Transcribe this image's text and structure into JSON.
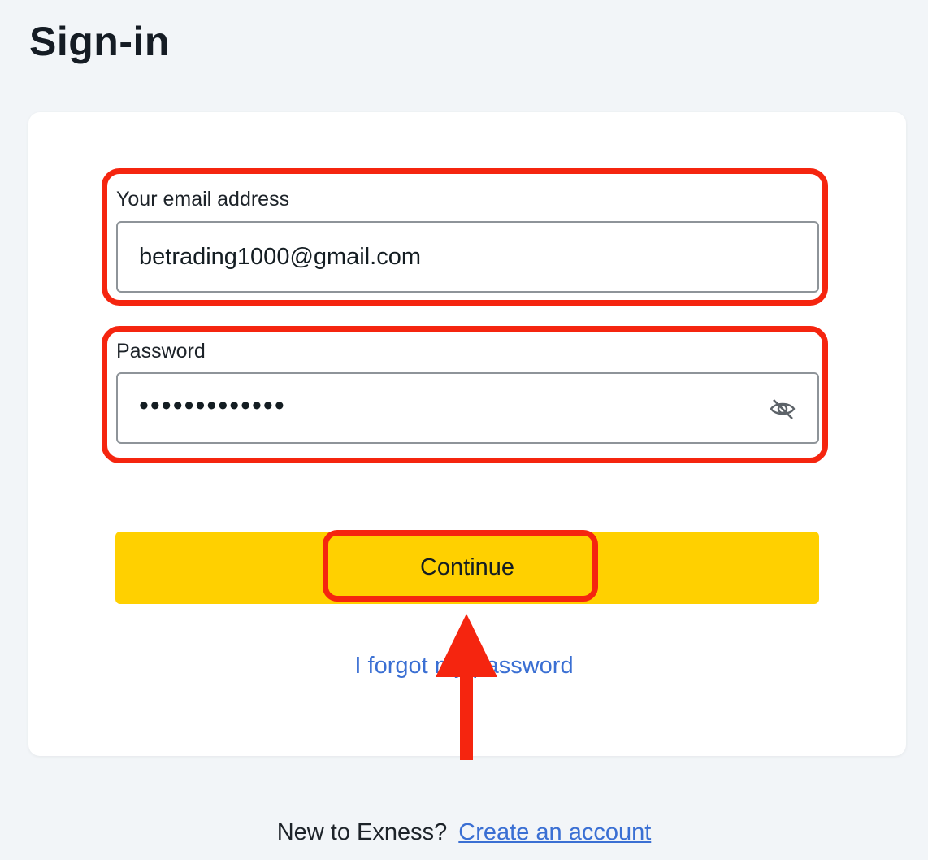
{
  "page": {
    "title": "Sign-in"
  },
  "form": {
    "email_label": "Your email address",
    "email_value": "betrading1000@gmail.com",
    "password_label": "Password",
    "password_value": "•••••••••••••",
    "password_toggle_icon": "eye-slash-icon",
    "continue_label": "Continue",
    "forgot_label": "I forgot my password"
  },
  "footer": {
    "prompt": "New to Exness?",
    "create_label": "Create an account"
  },
  "colors": {
    "accent_yellow": "#ffd000",
    "link_blue": "#3a6fd3",
    "highlight_red": "#f5250f"
  }
}
